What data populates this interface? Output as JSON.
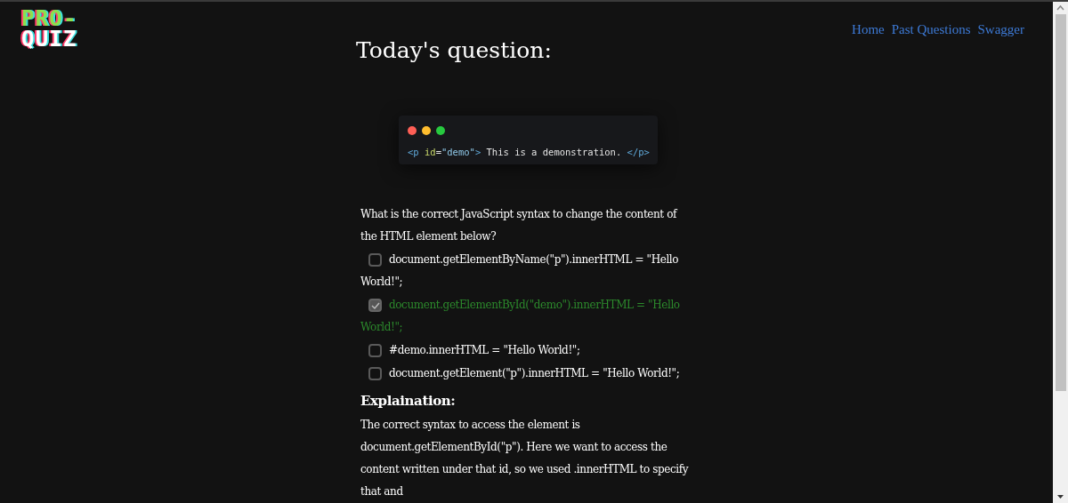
{
  "logo": {
    "line_1": "PRO-",
    "line_2": "QUIZ"
  },
  "nav": [
    "Home",
    "Past Questions",
    "Swagger"
  ],
  "heading": "Today's question:",
  "code": [
    {
      "text": "<p ",
      "kind": "tag"
    },
    {
      "text": "id",
      "kind": "attr"
    },
    {
      "text": "=",
      "kind": "plain"
    },
    {
      "text": "\"demo\"",
      "kind": "string"
    },
    {
      "text": "> ",
      "kind": "tag"
    },
    {
      "text": "This is a demonstration. ",
      "kind": "plain"
    },
    {
      "text": "</p>",
      "kind": "tag"
    }
  ],
  "question": "What is the correct JavaScript syntax to change the content of the HTML element below?",
  "options": [
    {
      "label": "document.getElementByName(\"p\").innerHTML = \"Hello World!\";",
      "checked": false
    },
    {
      "label": "document.getElementById(\"demo\").innerHTML = \"Hello World!\";",
      "checked": true
    },
    {
      "label": "#demo.innerHTML = \"Hello World!\";",
      "checked": false
    },
    {
      "label": "document.getElement(\"p\").innerHTML = \"Hello World!\";",
      "checked": false
    }
  ],
  "explanation": {
    "title": "Explaination:",
    "text": "The correct syntax to access the element is document.getElementById(\"p\"). Here we want to access the content written under that id, so we used .innerHTML to specify that and"
  }
}
